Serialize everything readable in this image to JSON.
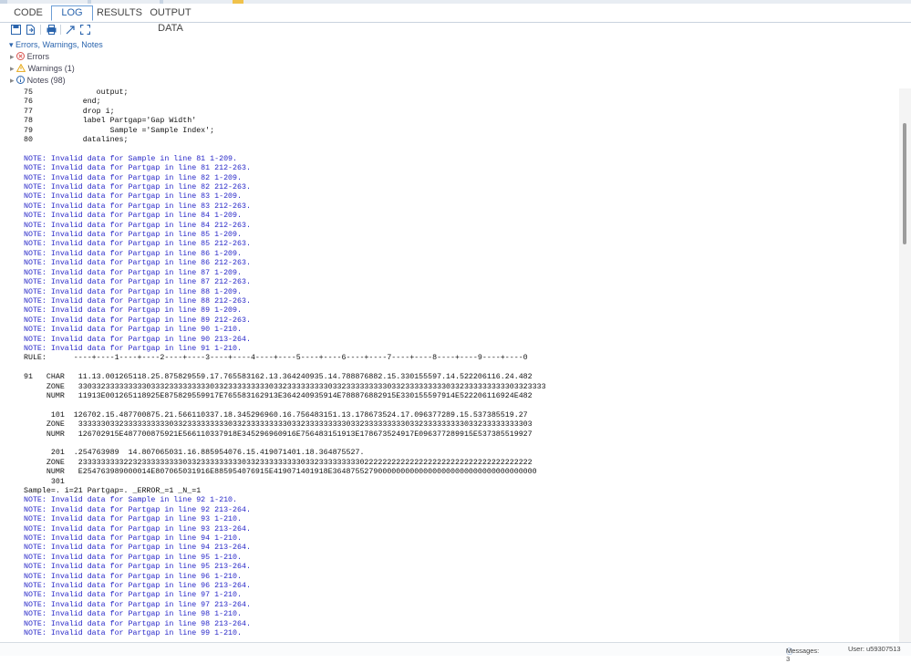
{
  "tabs": [
    {
      "label": "CODE",
      "active": false
    },
    {
      "label": "LOG",
      "active": true
    },
    {
      "label": "RESULTS",
      "active": false
    },
    {
      "label": "OUTPUT DATA",
      "active": false
    }
  ],
  "toolbar": {
    "icons": [
      "save-icon",
      "export-icon",
      "print-icon",
      "share-icon",
      "expand-icon"
    ]
  },
  "summary": {
    "header": "Errors, Warnings, Notes",
    "errors": "Errors",
    "warnings": "Warnings (1)",
    "notes": "Notes (98)"
  },
  "log_lines": [
    {
      "text": "75              output;",
      "type": "code"
    },
    {
      "text": "76           end;",
      "type": "code"
    },
    {
      "text": "77           drop i;",
      "type": "code"
    },
    {
      "text": "78           label Partgap='Gap Width'",
      "type": "code"
    },
    {
      "text": "79                 Sample ='Sample Index';",
      "type": "code"
    },
    {
      "text": "80           datalines;",
      "type": "code"
    },
    {
      "text": "",
      "type": "blank"
    },
    {
      "text": "NOTE: Invalid data for Sample in line 81 1-209.",
      "type": "note"
    },
    {
      "text": "NOTE: Invalid data for Partgap in line 81 212-263.",
      "type": "note"
    },
    {
      "text": "NOTE: Invalid data for Partgap in line 82 1-209.",
      "type": "note"
    },
    {
      "text": "NOTE: Invalid data for Partgap in line 82 212-263.",
      "type": "note"
    },
    {
      "text": "NOTE: Invalid data for Partgap in line 83 1-209.",
      "type": "note"
    },
    {
      "text": "NOTE: Invalid data for Partgap in line 83 212-263.",
      "type": "note"
    },
    {
      "text": "NOTE: Invalid data for Partgap in line 84 1-209.",
      "type": "note"
    },
    {
      "text": "NOTE: Invalid data for Partgap in line 84 212-263.",
      "type": "note"
    },
    {
      "text": "NOTE: Invalid data for Partgap in line 85 1-209.",
      "type": "note"
    },
    {
      "text": "NOTE: Invalid data for Partgap in line 85 212-263.",
      "type": "note"
    },
    {
      "text": "NOTE: Invalid data for Partgap in line 86 1-209.",
      "type": "note"
    },
    {
      "text": "NOTE: Invalid data for Partgap in line 86 212-263.",
      "type": "note"
    },
    {
      "text": "NOTE: Invalid data for Partgap in line 87 1-209.",
      "type": "note"
    },
    {
      "text": "NOTE: Invalid data for Partgap in line 87 212-263.",
      "type": "note"
    },
    {
      "text": "NOTE: Invalid data for Partgap in line 88 1-209.",
      "type": "note"
    },
    {
      "text": "NOTE: Invalid data for Partgap in line 88 212-263.",
      "type": "note"
    },
    {
      "text": "NOTE: Invalid data for Partgap in line 89 1-209.",
      "type": "note"
    },
    {
      "text": "NOTE: Invalid data for Partgap in line 89 212-263.",
      "type": "note"
    },
    {
      "text": "NOTE: Invalid data for Partgap in line 90 1-210.",
      "type": "note"
    },
    {
      "text": "NOTE: Invalid data for Partgap in line 90 213-264.",
      "type": "note"
    },
    {
      "text": "NOTE: Invalid data for Partgap in line 91 1-210.",
      "type": "note"
    },
    {
      "text": "RULE:      ----+----1----+----2----+----3----+----4----+----5----+----6----+----7----+----8----+----9----+----0",
      "type": "code"
    },
    {
      "text": "",
      "type": "blank"
    },
    {
      "text": "91   CHAR   11.13.001265118.25.875829559.17.765583162.13.364240935.14.788876882.15.330155597.14.522206116.24.482",
      "type": "code"
    },
    {
      "text": "     ZONE   3303323333333330333233333333303323333333330332333333333033233333333303323333333330332333333333303323333",
      "type": "code"
    },
    {
      "text": "     NUMR   11913E001265118925E875829559917E765583162913E364240935914E788876882915E330155597914E522206116924E482",
      "type": "code"
    },
    {
      "text": "",
      "type": "blank"
    },
    {
      "text": "      101  126702.15.487700875.21.566110337.18.345296960.16.756483151.13.178673524.17.096377289.15.537385519.27",
      "type": "code"
    },
    {
      "text": "     ZONE   3333330332333333333303323333333330332333333333033233333333303323333333330332333333333033233333333303",
      "type": "code"
    },
    {
      "text": "     NUMR   126702915E487700875921E566110337918E345296960916E756483151913E178673524917E096377289915E537385519927",
      "type": "code"
    },
    {
      "text": "",
      "type": "blank"
    },
    {
      "text": "      201  .254763989  14.807065031.16.885954076.15.419071401.18.364875527.",
      "type": "code"
    },
    {
      "text": "     ZONE   2333333333223233333333303323333333330332333333333033233333333302222222222222222222222222222222222222",
      "type": "code"
    },
    {
      "text": "     NUMR   E254763989000014E807065031916E885954076915E419071401918E364875527900000000000000000000000000000000000",
      "type": "code"
    },
    {
      "text": "      301",
      "type": "code"
    },
    {
      "text": "Sample=. i=21 Partgap=. _ERROR_=1 _N_=1",
      "type": "code"
    },
    {
      "text": "NOTE: Invalid data for Sample in line 92 1-210.",
      "type": "note"
    },
    {
      "text": "NOTE: Invalid data for Partgap in line 92 213-264.",
      "type": "note"
    },
    {
      "text": "NOTE: Invalid data for Partgap in line 93 1-210.",
      "type": "note"
    },
    {
      "text": "NOTE: Invalid data for Partgap in line 93 213-264.",
      "type": "note"
    },
    {
      "text": "NOTE: Invalid data for Partgap in line 94 1-210.",
      "type": "note"
    },
    {
      "text": "NOTE: Invalid data for Partgap in line 94 213-264.",
      "type": "note"
    },
    {
      "text": "NOTE: Invalid data for Partgap in line 95 1-210.",
      "type": "note"
    },
    {
      "text": "NOTE: Invalid data for Partgap in line 95 213-264.",
      "type": "note"
    },
    {
      "text": "NOTE: Invalid data for Partgap in line 96 1-210.",
      "type": "note"
    },
    {
      "text": "NOTE: Invalid data for Partgap in line 96 213-264.",
      "type": "note"
    },
    {
      "text": "NOTE: Invalid data for Partgap in line 97 1-210.",
      "type": "note"
    },
    {
      "text": "NOTE: Invalid data for Partgap in line 97 213-264.",
      "type": "note"
    },
    {
      "text": "NOTE: Invalid data for Partgap in line 98 1-210.",
      "type": "note"
    },
    {
      "text": "NOTE: Invalid data for Partgap in line 98 213-264.",
      "type": "note"
    },
    {
      "text": "NOTE: Invalid data for Partgap in line 99 1-210.",
      "type": "note"
    }
  ],
  "status": {
    "messages": "Messages: 3",
    "user": "User: u59307513"
  },
  "colors": {
    "note": "#2828c8",
    "code": "#111111",
    "error": "#d9534f",
    "warning": "#e6a817",
    "info": "#2a64ad",
    "accent": "#2a64ad"
  }
}
